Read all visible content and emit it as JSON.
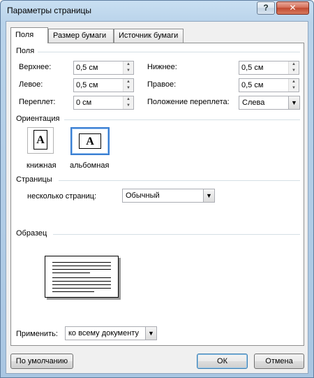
{
  "window": {
    "title": "Параметры страницы",
    "help": "?",
    "close": "✕"
  },
  "tabs": [
    "Поля",
    "Размер бумаги",
    "Источник бумаги"
  ],
  "margins": {
    "section": "Поля",
    "top_label": "Верхнее:",
    "top_value": "0,5 см",
    "bottom_label": "Нижнее:",
    "bottom_value": "0,5 см",
    "left_label": "Левое:",
    "left_value": "0,5 см",
    "right_label": "Правое:",
    "right_value": "0,5 см",
    "gutter_label": "Переплет:",
    "gutter_value": "0 см",
    "gutter_pos_label": "Положение переплета:",
    "gutter_pos_value": "Слева"
  },
  "orientation": {
    "section": "Ориентация",
    "portrait": "книжная",
    "landscape": "альбомная",
    "icon_letter": "A",
    "selected": "landscape"
  },
  "pages": {
    "section": "Страницы",
    "multiple_label": "несколько страниц:",
    "multiple_value": "Обычный"
  },
  "preview": {
    "section": "Образец"
  },
  "apply": {
    "label": "Применить:",
    "value": "ко всему документу"
  },
  "buttons": {
    "default": "По умолчанию",
    "ok": "ОК",
    "cancel": "Отмена"
  },
  "colors": {
    "accent": "#3a7fd2",
    "titlebar": "#b9d3ea",
    "close": "#c14a31"
  }
}
